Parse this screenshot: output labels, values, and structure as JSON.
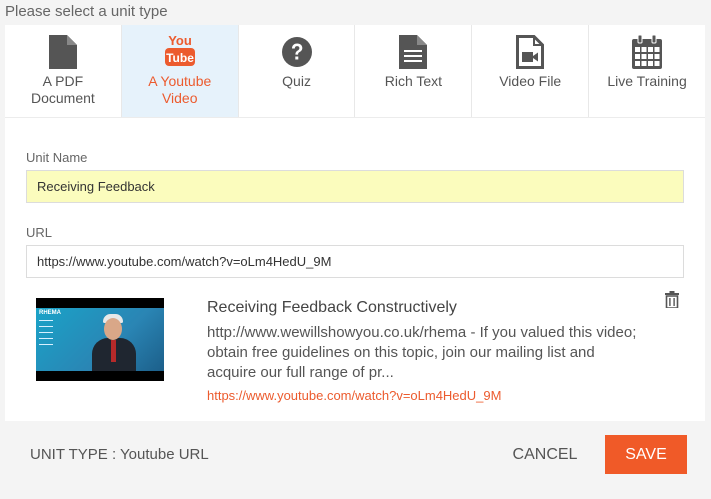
{
  "heading": "Please select a unit type",
  "unit_types": [
    {
      "label_line1": "A PDF",
      "label_line2": "Document",
      "icon": "pdf-document-icon"
    },
    {
      "label_line1": "A Youtube",
      "label_line2": "Video",
      "icon": "youtube-icon",
      "active": true
    },
    {
      "label_line1": "Quiz",
      "label_line2": "",
      "icon": "question-circle-icon"
    },
    {
      "label_line1": "Rich Text",
      "label_line2": "",
      "icon": "text-document-icon"
    },
    {
      "label_line1": "Video File",
      "label_line2": "",
      "icon": "video-file-icon"
    },
    {
      "label_line1": "Live Training",
      "label_line2": "",
      "icon": "calendar-icon"
    }
  ],
  "youtube_logo": {
    "top": "You",
    "bottom": "Tube"
  },
  "form": {
    "unit_name_label": "Unit Name",
    "unit_name_value": "Receiving Feedback",
    "url_label": "URL",
    "url_value": "https://www.youtube.com/watch?v=oLm4HedU_9M"
  },
  "preview": {
    "thumb_brand": "RHEMA",
    "title": "Receiving Feedback Constructively",
    "description": "http://www.wewillshowyou.co.uk/rhema - If you valued this video; obtain free guidelines on this topic, join our mailing list and acquire our full range of pr...",
    "link": "https://www.youtube.com/watch?v=oLm4HedU_9M"
  },
  "footer": {
    "unit_type_text": "UNIT TYPE : Youtube URL",
    "cancel_label": "CANCEL",
    "save_label": "SAVE"
  },
  "colors": {
    "accent": "#f05a28",
    "active_tab_bg": "#e6f2fb",
    "highlight_input": "#fbfcbd",
    "icon_gray": "#555555"
  }
}
